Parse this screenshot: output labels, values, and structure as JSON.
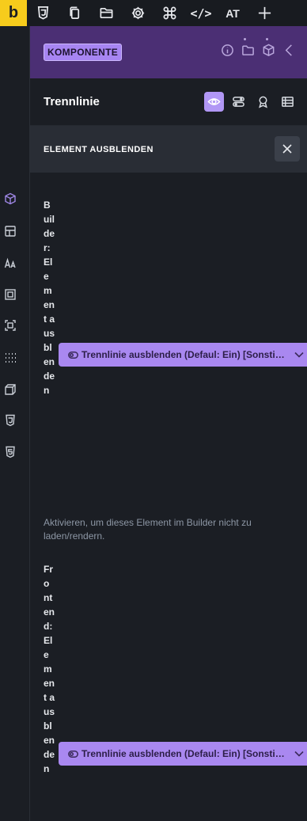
{
  "toolbar": {
    "logo": "b",
    "at_label": "AT",
    "code_label": "</>"
  },
  "panel": {
    "badge": "KOMPONENTE",
    "title": "Trennlinie",
    "section_title": "ELEMENT AUSBLENDEN"
  },
  "controls": [
    {
      "label": "Builder: Element ausblenden",
      "select_value": "Trennlinie ausblenden (Defaul: Ein) [Sonstige]",
      "description": "Aktivieren, um dieses Element im Builder nicht zu laden/rendern."
    },
    {
      "label": "Frontend: Element ausblenden",
      "select_value": "Trennlinie ausblenden (Defaul: Ein) [Sonstige]"
    }
  ],
  "colors": {
    "accent": "#a988f0",
    "header_bg": "#4b2f74",
    "logo_bg": "#f7cc1c",
    "panel_bg": "#1b1e24"
  }
}
